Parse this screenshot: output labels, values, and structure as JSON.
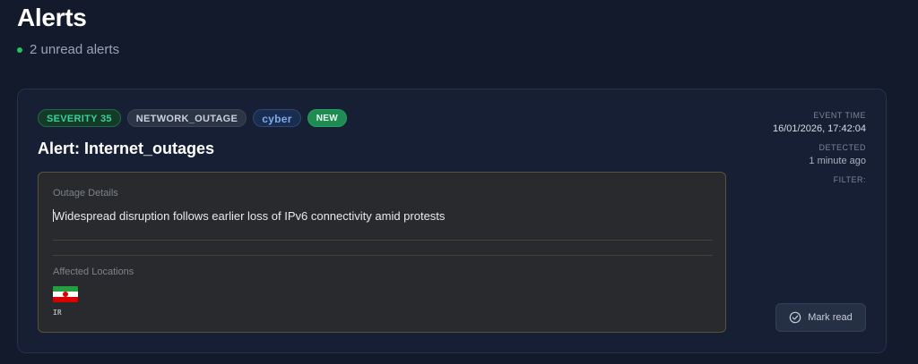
{
  "header": {
    "title": "Alerts",
    "unread_text": "2 unread alerts"
  },
  "alert": {
    "badges": {
      "severity": "SEVERITY 35",
      "type": "NETWORK_OUTAGE",
      "category": "cyber",
      "status": "NEW"
    },
    "title": "Alert: Internet_outages",
    "meta": {
      "event_time_label": "EVENT TIME",
      "event_time_value": "16/01/2026, 17:42:04",
      "detected_label": "DETECTED",
      "detected_value": "1 minute ago",
      "filter_label": "FILTER:"
    },
    "details": {
      "outage_label": "Outage Details",
      "outage_text": "Widespread disruption follows earlier loss of IPv6 connectivity amid protests",
      "locations_label": "Affected Locations",
      "locations": [
        {
          "code": "IR",
          "flag_icon": "iran-flag-icon"
        }
      ]
    },
    "mark_read_label": "Mark read"
  },
  "colors": {
    "background": "#131a2c",
    "card": "#161f33",
    "severity_green": "#34d399",
    "new_badge": "#1f8a52",
    "category_blue": "#7fa8f0",
    "details_border": "#5a5236"
  }
}
